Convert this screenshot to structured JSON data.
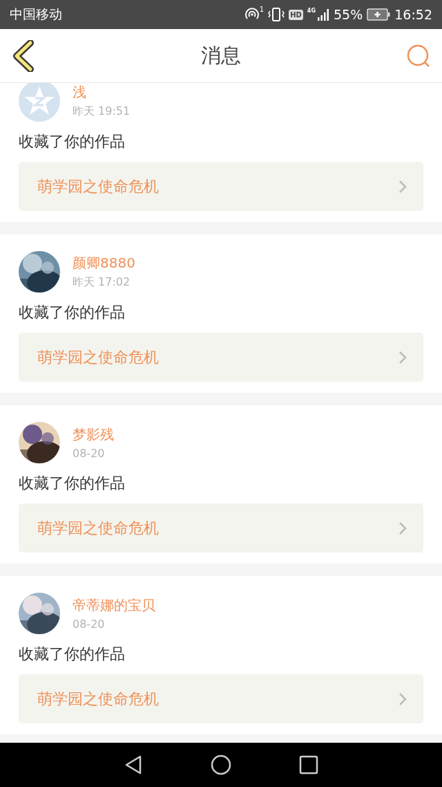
{
  "status_bar": {
    "carrier": "中国移动",
    "hotspot_count": "1",
    "hd": "HD",
    "network": "4G",
    "battery": "55%",
    "time": "16:52"
  },
  "header": {
    "title": "消息"
  },
  "messages": [
    {
      "kind": "default",
      "name": "浅",
      "time": "昨天 19:51",
      "action": "收藏了你的作品",
      "work": "萌学园之使命危机"
    },
    {
      "kind": "picture",
      "name": "颜卿8880",
      "time": "昨天 17:02",
      "action": "收藏了你的作品",
      "work": "萌学园之使命危机"
    },
    {
      "kind": "picture",
      "name": "梦影残",
      "time": "08-20",
      "action": "收藏了你的作品",
      "work": "萌学园之使命危机"
    },
    {
      "kind": "picture",
      "name": "帝蒂娜的宝贝",
      "time": "08-20",
      "action": "收藏了你的作品",
      "work": "萌学园之使命危机"
    }
  ]
}
